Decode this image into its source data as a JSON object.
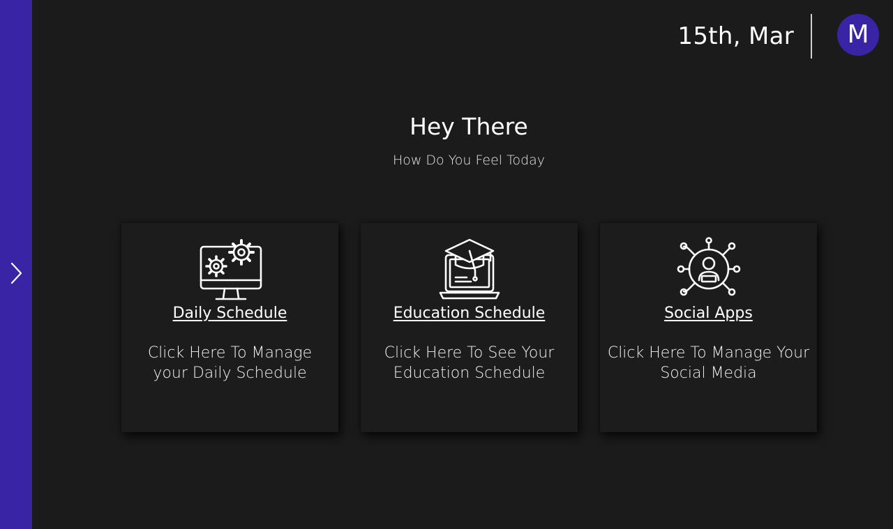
{
  "header": {
    "date": "15th, Mar",
    "avatar_initial": "M"
  },
  "greeting": {
    "title": "Hey There",
    "subtitle": "How Do You Feel Today"
  },
  "cards": [
    {
      "title": "Daily Schedule",
      "description": "Click Here To Manage your Daily Schedule",
      "icon": "monitor-gears-icon"
    },
    {
      "title": "Education Schedule",
      "description": "Click Here To See Your Education Schedule",
      "icon": "laptop-graduation-cap-icon"
    },
    {
      "title": "Social Apps",
      "description": "Click Here To Manage Your Social Media",
      "icon": "user-network-icon"
    }
  ],
  "colors": {
    "accent": "#3a24a6",
    "background": "#1b1b1b",
    "card": "#1c1c1c",
    "text": "#ffffff"
  }
}
